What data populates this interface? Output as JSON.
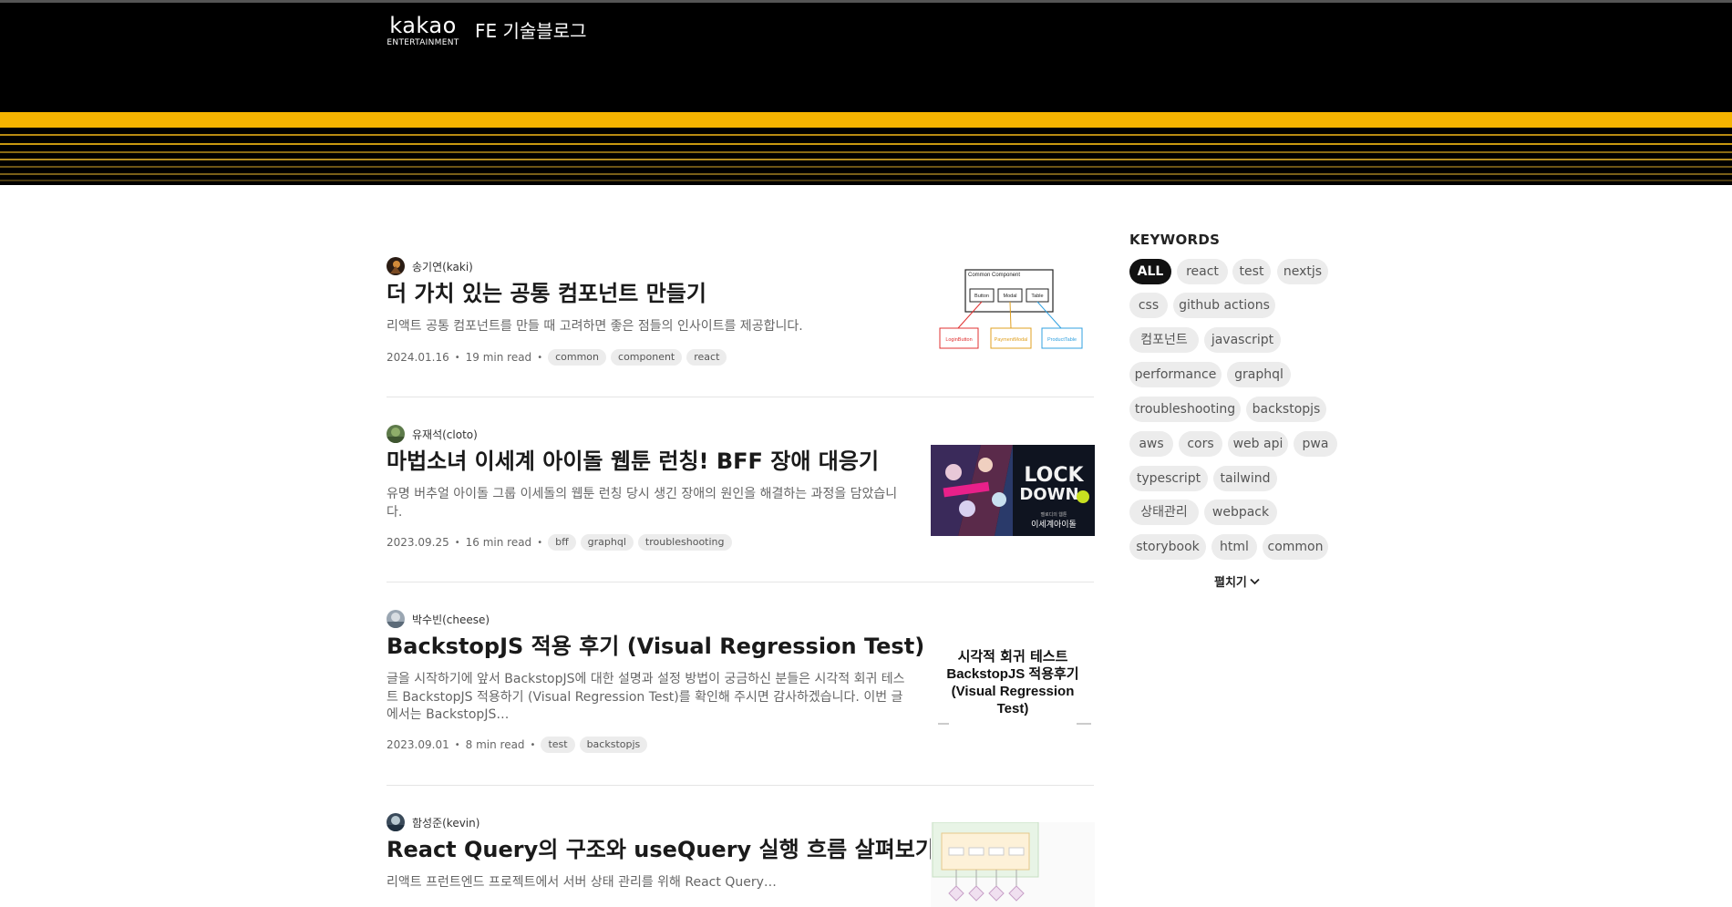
{
  "header": {
    "brand_wordmark": "kakao",
    "brand_sub": "ENTERTAINMENT",
    "blog_title": "FE 기술블로그"
  },
  "posts": [
    {
      "author": "송기연(kaki)",
      "title": "더 가치 있는 공통 컴포넌트 만들기",
      "description": "리액트 공통 컴포넌트를 만들 때 고려하면 좋은 점들의 인사이트를 제공합니다.",
      "date": "2024.01.16",
      "read_time": "19 min read",
      "tags": [
        "common",
        "component",
        "react"
      ],
      "thumbnail": {
        "top": "Common Component",
        "mid": [
          "Button",
          "Modal",
          "Table"
        ],
        "bottom": [
          "LoginButton",
          "PaymentModal",
          "ProductTable"
        ]
      }
    },
    {
      "author": "유재석(cloto)",
      "title": "마법소녀 이세계 아이돌 웹툰 런칭! BFF 장애 대응기",
      "description": "유명 버추얼 아이돌 그룹 이세돌의 웹툰 런칭 당시 생긴 장애의 원인을 해결하는 과정을 담았습니다.",
      "date": "2023.09.25",
      "read_time": "16 min read",
      "tags": [
        "bff",
        "graphql",
        "troubleshooting"
      ],
      "thumbnail": {
        "text_a": "LOCK",
        "text_b": "DOWN",
        "caption_small": "멜로디의 웹툰",
        "caption": "이세계아이돌"
      }
    },
    {
      "author": "박수빈(cheese)",
      "title": "BackstopJS 적용 후기 (Visual Regression Test)",
      "description": "글을 시작하기에 앞서 BackstopJS에 대한 설명과 설정 방법이 궁금하신 분들은 시각적 회귀 테스트 BackstopJS 적용하기 (Visual Regression Test)를 확인해 주시면 감사하겠습니다. 이번 글에서는 BackstopJS…",
      "date": "2023.09.01",
      "read_time": "8 min read",
      "tags": [
        "test",
        "backstopjs"
      ],
      "thumbnail": {
        "lines": [
          "시각적 회귀 테스트",
          "BackstopJS 적용후기",
          "(Visual Regression",
          "Test)"
        ]
      }
    },
    {
      "author": "함성준(kevin)",
      "title": "React Query의 구조와 useQuery 실행 흐름 살펴보기",
      "description": "리액트 프런트엔드 프로젝트에서 서버 상태 관리를 위해 React Query…",
      "date": "",
      "read_time": "",
      "tags": [],
      "thumbnail": {}
    }
  ],
  "keywords": {
    "title": "KEYWORDS",
    "items": [
      "ALL",
      "react",
      "test",
      "nextjs",
      "css",
      "github actions",
      "컴포넌트",
      "javascript",
      "performance",
      "graphql",
      "troubleshooting",
      "backstopjs",
      "aws",
      "cors",
      "web api",
      "pwa",
      "typescript",
      "tailwind",
      "상태관리",
      "webpack",
      "storybook",
      "html",
      "common"
    ],
    "active": "ALL",
    "expand_label": "펼치기"
  },
  "colors": {
    "header_bg": "#000000",
    "accent_yellow": "#f6b400",
    "chip_bg": "#ececec",
    "chip_active_bg": "#111111"
  }
}
